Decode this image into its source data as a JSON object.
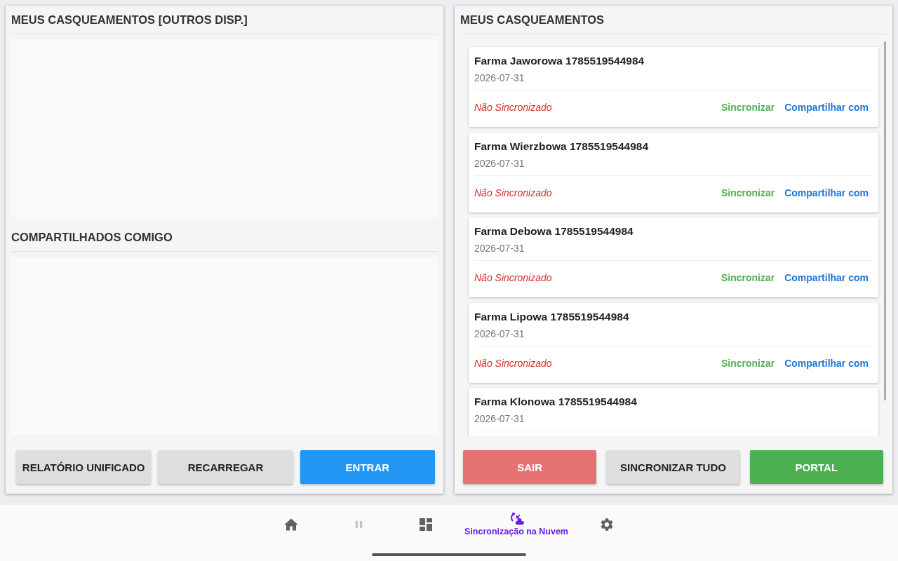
{
  "left_panel": {
    "sections": [
      {
        "title": "MEUS CASQUEAMENTOS [OUTROS DISP.]"
      },
      {
        "title": "COMPARTILHADOS COMIGO"
      }
    ],
    "buttons": [
      {
        "label": "RELATÓRIO UNIFICADO",
        "kind": "default"
      },
      {
        "label": "RECARREGAR",
        "kind": "default"
      },
      {
        "label": "ENTRAR",
        "kind": "primary"
      }
    ]
  },
  "right_panel": {
    "title": "MEUS CASQUEAMENTOS",
    "items": [
      {
        "title": "Farma Jaworowa 1785519544984",
        "date": "2026-07-31",
        "status": "Não Sincronizado",
        "synced": false,
        "actions": [
          {
            "label": "Sincronizar",
            "kind": "sync"
          },
          {
            "label": "Compartilhar com",
            "kind": "share"
          }
        ]
      },
      {
        "title": "Farma Wierzbowa 1785519544984",
        "date": "2026-07-31",
        "status": "Não Sincronizado",
        "synced": false,
        "actions": [
          {
            "label": "Sincronizar",
            "kind": "sync"
          },
          {
            "label": "Compartilhar com",
            "kind": "share"
          }
        ]
      },
      {
        "title": "Farma Debowa 1785519544984",
        "date": "2026-07-31",
        "status": "Não Sincronizado",
        "synced": false,
        "actions": [
          {
            "label": "Sincronizar",
            "kind": "sync"
          },
          {
            "label": "Compartilhar com",
            "kind": "share"
          }
        ]
      },
      {
        "title": "Farma Lipowa 1785519544984",
        "date": "2026-07-31",
        "status": "Não Sincronizado",
        "synced": false,
        "actions": [
          {
            "label": "Sincronizar",
            "kind": "sync"
          },
          {
            "label": "Compartilhar com",
            "kind": "share"
          }
        ]
      },
      {
        "title": "Farma Klonowa 1785519544984",
        "date": "2026-07-31"
      }
    ],
    "buttons": [
      {
        "label": "SAIR",
        "kind": "danger"
      },
      {
        "label": "SINCRONIZAR TUDO",
        "kind": "default"
      },
      {
        "label": "PORTAL",
        "kind": "success"
      }
    ]
  },
  "bottom_nav": {
    "items": [
      {
        "kind": "home",
        "selected": false,
        "disabled": false
      },
      {
        "kind": "pause",
        "selected": false,
        "disabled": true
      },
      {
        "kind": "dashboard",
        "selected": false,
        "disabled": false
      },
      {
        "kind": "cloud-sync",
        "selected": true,
        "disabled": false,
        "label": "Sincronização na Nuvem"
      },
      {
        "kind": "settings",
        "selected": false,
        "disabled": false
      }
    ]
  }
}
